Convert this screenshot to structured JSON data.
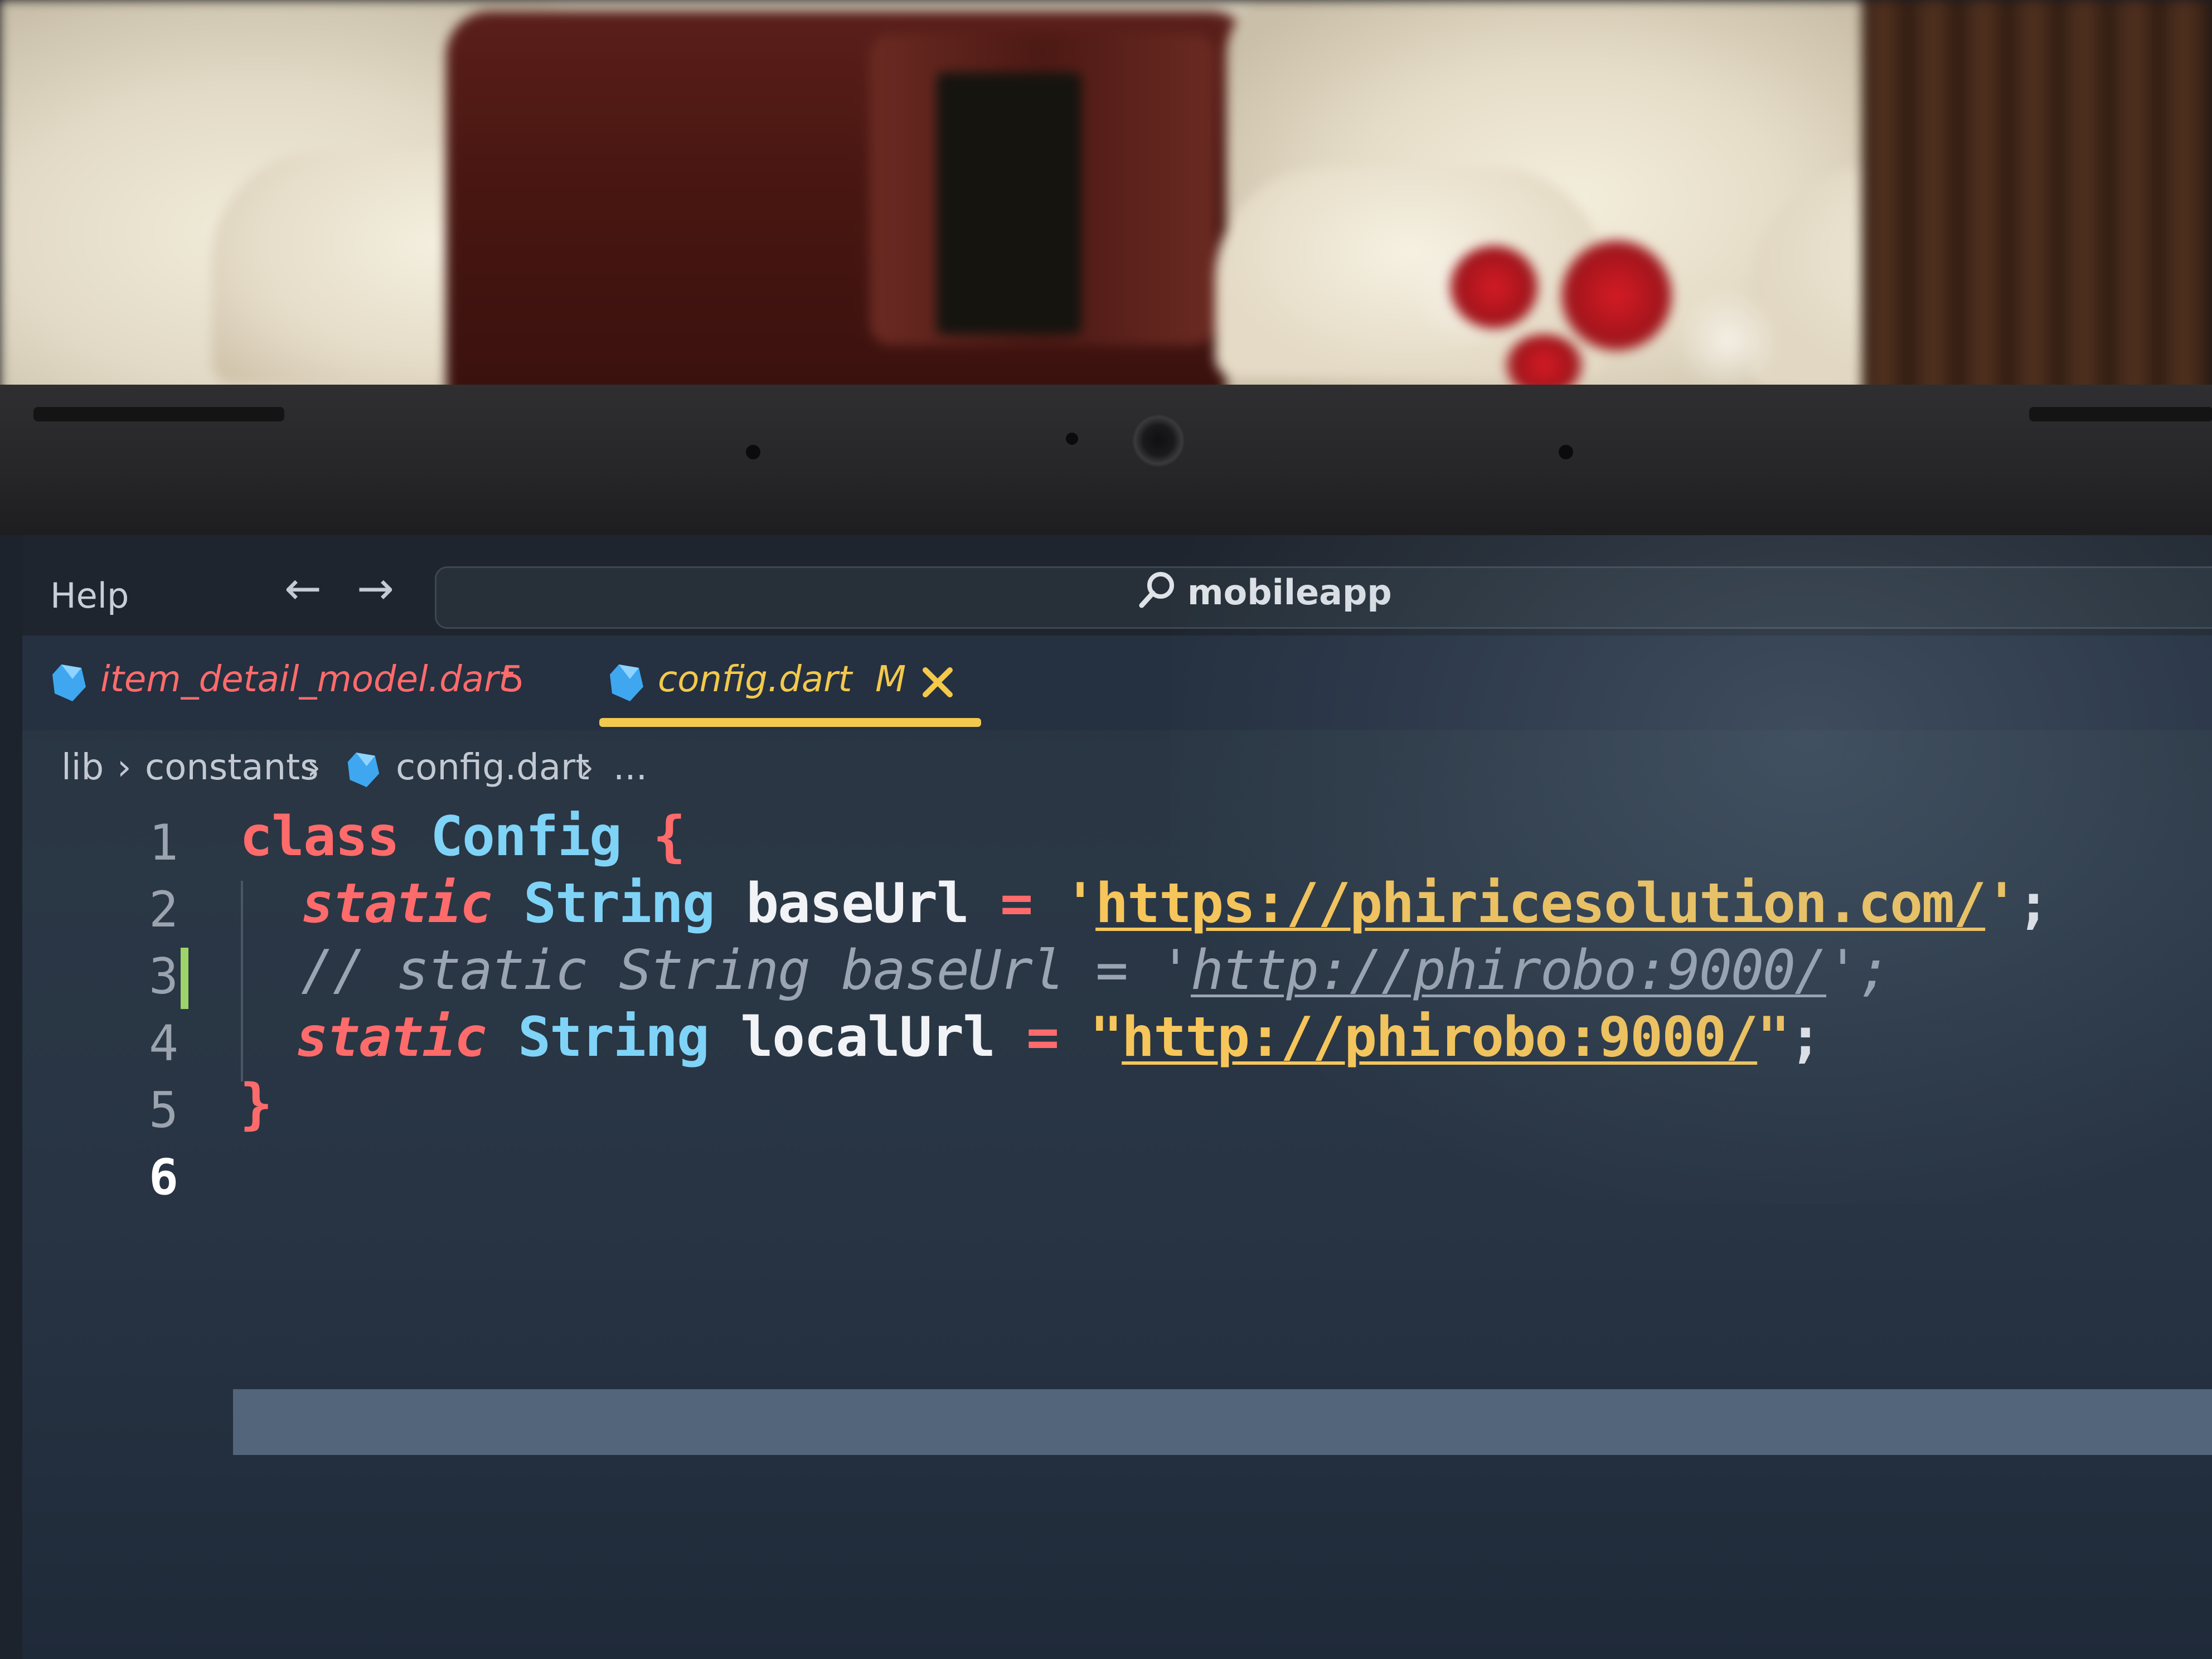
{
  "titlebar": {
    "menu_item": "Help",
    "back_icon": "arrow-left-icon",
    "forward_icon": "arrow-right-icon",
    "search_icon": "search-icon",
    "search_label": "mobileapp"
  },
  "tabs": [
    {
      "icon": "dart-icon",
      "label": "item_detail_model.dart",
      "badge": "5",
      "active": false,
      "color": "#ff6b6b"
    },
    {
      "icon": "dart-icon",
      "label": "config.dart",
      "badge": "M",
      "active": true,
      "color": "#f2c94c",
      "close_icon": "close-icon"
    }
  ],
  "breadcrumb": {
    "items": [
      "lib",
      "constants",
      "config.dart",
      "..."
    ],
    "separator_icon": "chevron-right-icon",
    "file_icon": "dart-icon"
  },
  "editor": {
    "line_numbers": [
      "1",
      "2",
      "3",
      "4",
      "5",
      "6"
    ],
    "current_line": "6",
    "lines": [
      {
        "kw": "class",
        "type": "Config",
        "brace": "{"
      },
      {
        "kw": "static",
        "type": "String",
        "id": "baseUrl",
        "op": "=",
        "q1": "'",
        "url": "https://phiricesolution.com/",
        "q2": "'",
        "end": ";"
      },
      {
        "comment": "// static String baseUrl = '",
        "url": "http://phirobo:9000/",
        "tail": "';"
      },
      {
        "kw": "static",
        "type": "String",
        "id": "localUrl",
        "op": "=",
        "q1": "\"",
        "url": "http://phirobo:9000/",
        "q2": "\"",
        "end": ";"
      },
      {
        "brace": "}"
      },
      {}
    ]
  },
  "colors": {
    "keyword": "#ff6b6b",
    "type": "#7fd3f7",
    "string": "#f7c65a",
    "active_tab_accent": "#f2c94c",
    "git_modified": "#9ed36a"
  }
}
